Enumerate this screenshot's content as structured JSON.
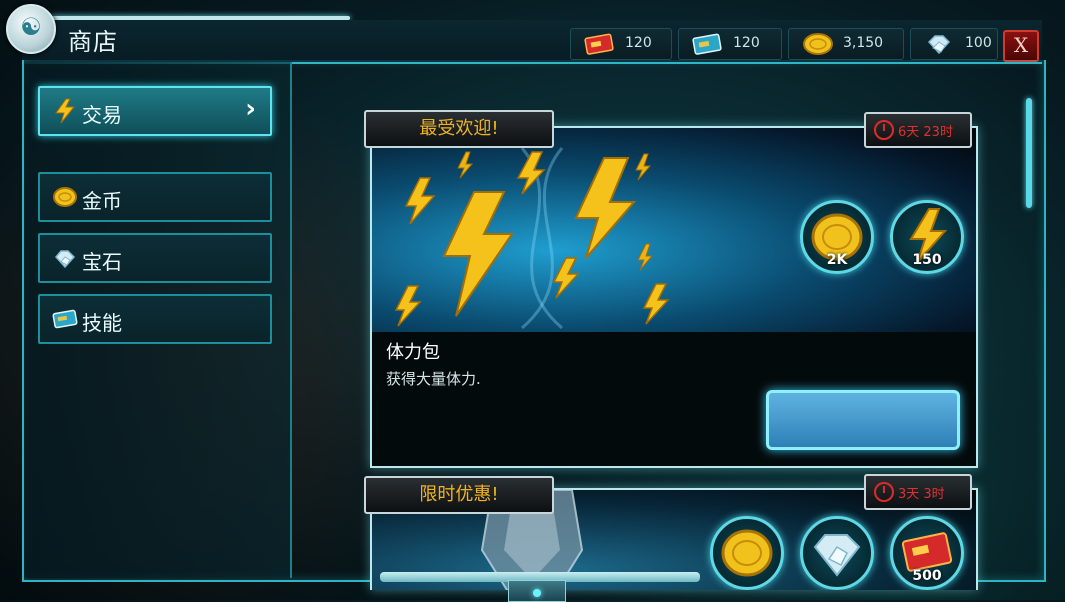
{
  "header": {
    "title": "商店",
    "close_label": "X",
    "currencies": [
      {
        "icon": "red-card-icon",
        "value": "120"
      },
      {
        "icon": "blue-card-icon",
        "value": "120"
      },
      {
        "icon": "gold-coin-icon",
        "value": "3,150"
      },
      {
        "icon": "diamond-icon",
        "value": "100"
      }
    ]
  },
  "sidebar": {
    "items": [
      {
        "icon": "lightning-icon",
        "label": "交易",
        "active": true
      },
      {
        "icon": "gold-coin-icon",
        "label": "金币"
      },
      {
        "icon": "gem-icon",
        "label": "宝石"
      },
      {
        "icon": "skill-card-icon",
        "label": "技能"
      }
    ],
    "active_arrow": "›"
  },
  "offers": [
    {
      "tag": "最受欢迎!",
      "timer": "6天 23时",
      "name": "体力包",
      "description": "获得大量体力.",
      "rewards": [
        {
          "icon": "gold-coin-icon",
          "amount": "2K"
        },
        {
          "icon": "lightning-icon",
          "amount": "150"
        }
      ]
    },
    {
      "tag": "限时优惠!",
      "timer": "3天 3时",
      "rewards": [
        {
          "icon": "gold-coin-icon",
          "amount": ""
        },
        {
          "icon": "diamond-icon",
          "amount": ""
        },
        {
          "icon": "red-card-icon",
          "amount": "500"
        }
      ]
    }
  ],
  "colors": {
    "accent": "#2fb4c4",
    "tag_text": "#f0b420",
    "timer_text": "#e03030",
    "close_red": "#8a1010"
  }
}
